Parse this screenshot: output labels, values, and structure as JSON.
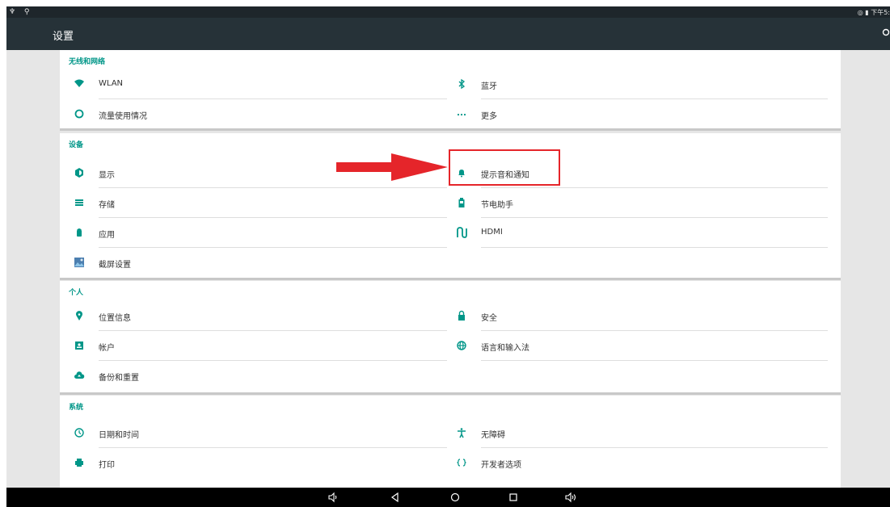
{
  "status_bar": {
    "left_icons": "♆ ⚲",
    "time": "下午5:"
  },
  "app_bar": {
    "title": "设置",
    "search_icon": "search-icon"
  },
  "sections": [
    {
      "header": "无线和网络",
      "items": [
        {
          "label": "WLAN",
          "icon": "wifi-icon"
        },
        {
          "label": "蓝牙",
          "icon": "bluetooth-icon"
        },
        {
          "label": "流量使用情况",
          "icon": "data-usage-icon"
        },
        {
          "label": "更多",
          "icon": "more-icon"
        }
      ]
    },
    {
      "header": "设备",
      "items": [
        {
          "label": "显示",
          "icon": "display-icon"
        },
        {
          "label": "提示音和通知",
          "icon": "bell-icon"
        },
        {
          "label": "存储",
          "icon": "storage-icon"
        },
        {
          "label": "节电助手",
          "icon": "battery-icon"
        },
        {
          "label": "应用",
          "icon": "android-icon"
        },
        {
          "label": "HDMI",
          "icon": "hdmi-icon"
        },
        {
          "label": "截屏设置",
          "icon": "screenshot-icon"
        }
      ]
    },
    {
      "header": "个人",
      "items": [
        {
          "label": "位置信息",
          "icon": "location-icon"
        },
        {
          "label": "安全",
          "icon": "lock-icon"
        },
        {
          "label": "帐户",
          "icon": "account-icon"
        },
        {
          "label": "语言和输入法",
          "icon": "globe-icon"
        },
        {
          "label": "备份和重置",
          "icon": "cloud-upload-icon"
        }
      ]
    },
    {
      "header": "系统",
      "items": [
        {
          "label": "日期和时间",
          "icon": "clock-icon"
        },
        {
          "label": "无障碍",
          "icon": "accessibility-icon"
        },
        {
          "label": "打印",
          "icon": "print-icon"
        },
        {
          "label": "开发者选项",
          "icon": "developer-options-icon"
        }
      ]
    }
  ],
  "nav_bar": {
    "buttons": [
      "volume-down-icon",
      "back-icon",
      "home-icon",
      "recents-icon",
      "volume-up-icon"
    ]
  },
  "annotation": {
    "highlight_color": "#e5252a",
    "highlighted_item": "提示音和通知"
  },
  "colors": {
    "accent": "#009688",
    "app_bar": "#263238",
    "status_bar": "#1e262b"
  }
}
